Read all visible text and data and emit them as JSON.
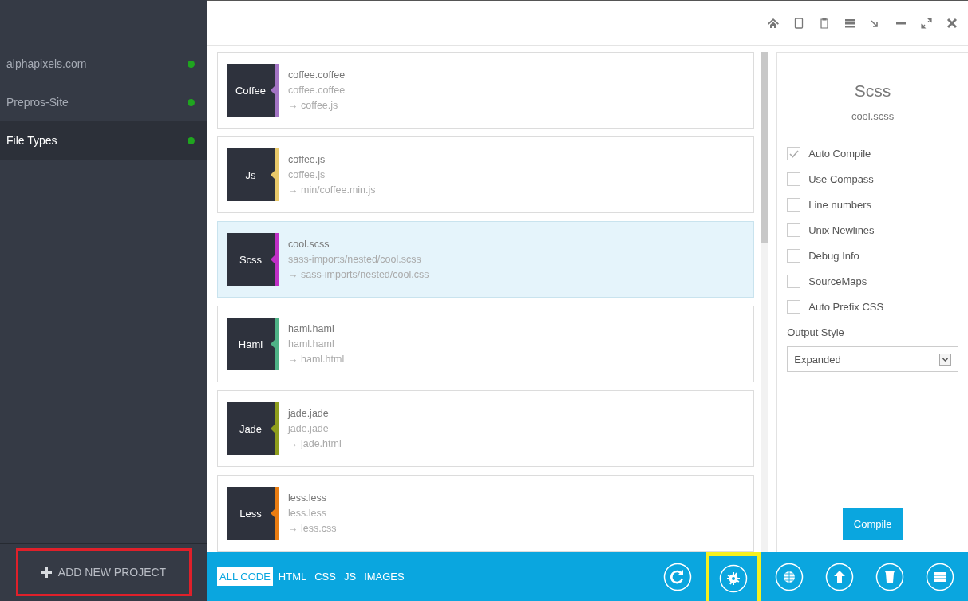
{
  "projects": [
    {
      "name": "alphapixels.com",
      "selected": false,
      "color": "#1fa51f"
    },
    {
      "name": "Prepros-Site",
      "selected": false,
      "color": "#1fa51f"
    },
    {
      "name": "File Types",
      "selected": true,
      "color": "#1fa51f"
    }
  ],
  "add_project": {
    "label": "ADD NEW PROJECT",
    "highlighted": true
  },
  "files": [
    {
      "type": "Coffee",
      "color": "#a374c4",
      "name": "coffee.coffee",
      "path": "coffee.coffee",
      "output": "→ coffee.js",
      "selected": false
    },
    {
      "type": "Js",
      "color": "#e9c96a",
      "name": "coffee.js",
      "path": "coffee.js",
      "output": "→ min/coffee.min.js",
      "selected": false
    },
    {
      "type": "Scss",
      "color": "#c02fc6",
      "name": "cool.scss",
      "path": "sass-imports/nested/cool.scss",
      "output": "→ sass-imports/nested/cool.css",
      "selected": true
    },
    {
      "type": "Haml",
      "color": "#4fb387",
      "name": "haml.haml",
      "path": "haml.haml",
      "output": "→ haml.html",
      "selected": false
    },
    {
      "type": "Jade",
      "color": "#8f9e1c",
      "name": "jade.jade",
      "path": "jade.jade",
      "output": "→ jade.html",
      "selected": false
    },
    {
      "type": "Less",
      "color": "#ea7d12",
      "name": "less.less",
      "path": "less.less",
      "output": "→ less.css",
      "selected": false
    }
  ],
  "details": {
    "title": "Scss",
    "file": "cool.scss",
    "options": [
      {
        "label": "Auto Compile",
        "checked": true
      },
      {
        "label": "Use Compass",
        "checked": false
      },
      {
        "label": "Line numbers",
        "checked": false
      },
      {
        "label": "Unix Newlines",
        "checked": false
      },
      {
        "label": "Debug Info",
        "checked": false
      },
      {
        "label": "SourceMaps",
        "checked": false
      },
      {
        "label": "Auto Prefix CSS",
        "checked": false
      }
    ],
    "output_style_label": "Output Style",
    "output_style": "Expanded",
    "compile_button": "Compile"
  },
  "filters": [
    {
      "label": "ALL CODE",
      "selected": true
    },
    {
      "label": "HTML",
      "selected": false
    },
    {
      "label": "CSS",
      "selected": false
    },
    {
      "label": "JS",
      "selected": false
    },
    {
      "label": "IMAGES",
      "selected": false
    }
  ],
  "actions": [
    {
      "kind": "refresh",
      "highlighted": false
    },
    {
      "kind": "settings",
      "highlighted": true
    },
    {
      "kind": "globe",
      "highlighted": false
    },
    {
      "kind": "upload",
      "highlighted": false
    },
    {
      "kind": "trash",
      "highlighted": false
    },
    {
      "kind": "menu",
      "highlighted": false
    }
  ]
}
